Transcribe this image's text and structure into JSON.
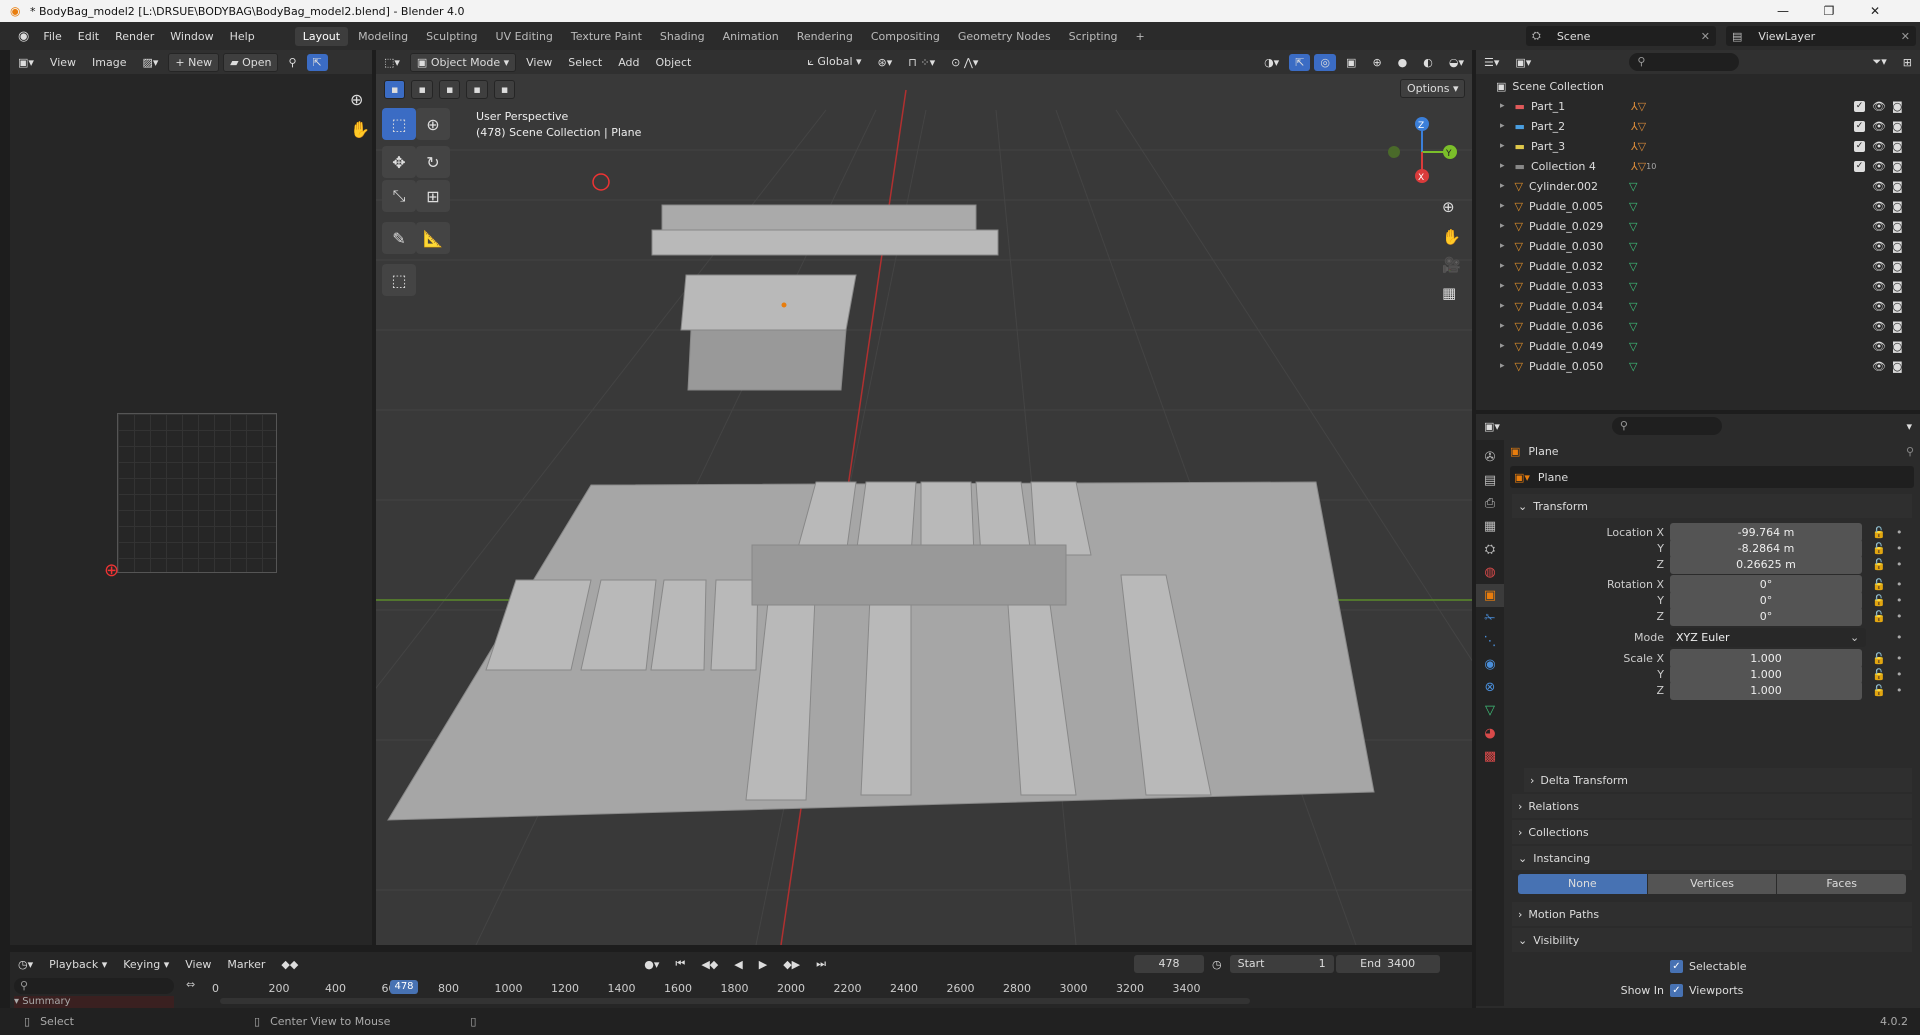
{
  "window": {
    "title": "* BodyBag_model2 [L:\\DRSUE\\BODYBAG\\BodyBag_model2.blend] - Blender 4.0"
  },
  "menu": [
    "File",
    "Edit",
    "Render",
    "Window",
    "Help"
  ],
  "workspaces": [
    "Layout",
    "Modeling",
    "Sculpting",
    "UV Editing",
    "Texture Paint",
    "Shading",
    "Animation",
    "Rendering",
    "Compositing",
    "Geometry Nodes",
    "Scripting"
  ],
  "active_workspace": "Layout",
  "scene": {
    "name": "Scene",
    "view_layer": "ViewLayer"
  },
  "image_editor": {
    "menus": [
      "View",
      "Image"
    ],
    "new_label": "New",
    "open_label": "Open"
  },
  "viewport": {
    "mode": "Object Mode",
    "menus": [
      "View",
      "Select",
      "Add",
      "Object"
    ],
    "orientation": "Global",
    "options_label": "Options",
    "perspective_label": "User Perspective",
    "collection_label": "(478) Scene Collection | Plane"
  },
  "outliner": {
    "root": "Scene Collection",
    "items": [
      {
        "name": "Part_1",
        "type": "collection",
        "color": "#e05a5a",
        "badge": ""
      },
      {
        "name": "Part_2",
        "type": "collection",
        "color": "#4a9ee0",
        "badge": ""
      },
      {
        "name": "Part_3",
        "type": "collection",
        "color": "#e0c84a",
        "badge": ""
      },
      {
        "name": "Collection 4",
        "type": "collection",
        "color": "#888888",
        "badge": "10"
      },
      {
        "name": "Cylinder.002",
        "type": "mesh",
        "color": "#e0902a",
        "badge": ""
      },
      {
        "name": "Puddle_0.005",
        "type": "mesh",
        "color": "#e0902a",
        "badge": ""
      },
      {
        "name": "Puddle_0.029",
        "type": "mesh",
        "color": "#e0902a",
        "badge": ""
      },
      {
        "name": "Puddle_0.030",
        "type": "mesh",
        "color": "#e0902a",
        "badge": ""
      },
      {
        "name": "Puddle_0.032",
        "type": "mesh",
        "color": "#e0902a",
        "badge": ""
      },
      {
        "name": "Puddle_0.033",
        "type": "mesh",
        "color": "#e0902a",
        "badge": ""
      },
      {
        "name": "Puddle_0.034",
        "type": "mesh",
        "color": "#e0902a",
        "badge": ""
      },
      {
        "name": "Puddle_0.036",
        "type": "mesh",
        "color": "#e0902a",
        "badge": ""
      },
      {
        "name": "Puddle_0.049",
        "type": "mesh",
        "color": "#e0902a",
        "badge": ""
      },
      {
        "name": "Puddle_0.050",
        "type": "mesh",
        "color": "#e0902a",
        "badge": ""
      }
    ]
  },
  "properties": {
    "object_name": "Plane",
    "data_name": "Plane",
    "transform_label": "Transform",
    "location": {
      "label": "Location X",
      "x": "-99.764 m",
      "y": "-8.2864 m",
      "z": "0.26625 m"
    },
    "rotation": {
      "label": "Rotation X",
      "x": "0°",
      "y": "0°",
      "z": "0°"
    },
    "mode": {
      "label": "Mode",
      "value": "XYZ Euler"
    },
    "scale": {
      "label": "Scale X",
      "x": "1.000",
      "y": "1.000",
      "z": "1.000"
    },
    "axis_y": "Y",
    "axis_z": "Z",
    "sections": {
      "delta": "Delta Transform",
      "relations": "Relations",
      "collections": "Collections",
      "instancing": "Instancing",
      "motion": "Motion Paths",
      "visibility": "Visibility"
    },
    "instancing_options": [
      "None",
      "Vertices",
      "Faces"
    ],
    "selectable_label": "Selectable",
    "show_in_label": "Show In",
    "viewports_label": "Viewports"
  },
  "timeline": {
    "menus": [
      "Playback",
      "Keying",
      "View",
      "Marker"
    ],
    "current_frame": "478",
    "start_label": "Start",
    "start": "1",
    "end_label": "End",
    "end": "3400",
    "ticks": [
      "0",
      "200",
      "400",
      "600",
      "800",
      "1000",
      "1200",
      "1400",
      "1600",
      "1800",
      "2000",
      "2200",
      "2400",
      "2600",
      "2800",
      "3000",
      "3200",
      "3400"
    ],
    "summary_label": "Summary"
  },
  "status": {
    "left": "Select",
    "middle": "Center View to Mouse",
    "version": "4.0.2"
  }
}
